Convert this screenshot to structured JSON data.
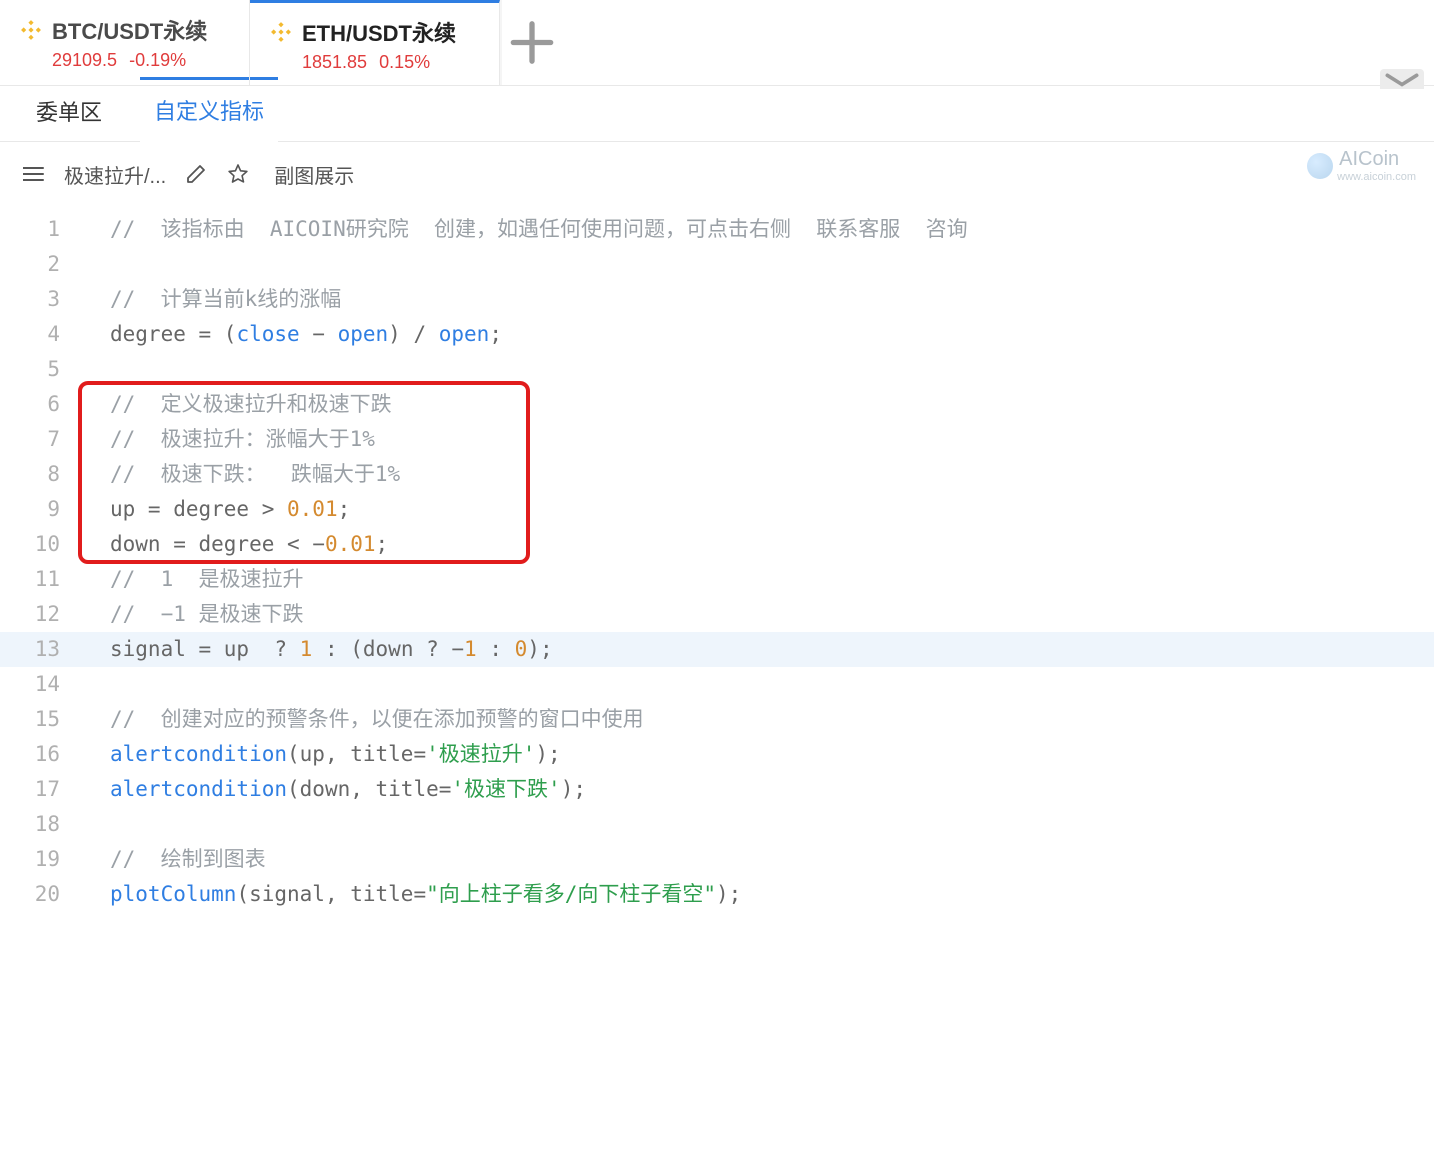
{
  "tabs": [
    {
      "name": "BTC/USDT永续",
      "price": "29109.5",
      "change": "-0.19%"
    },
    {
      "name": "ETH/USDT永续",
      "price": "1851.85",
      "change": "0.15%"
    }
  ],
  "subnav": {
    "orders": "委单区",
    "custom": "自定义指标"
  },
  "toolbar": {
    "script_name": "极速拉升/...",
    "side_label": "副图展示"
  },
  "watermark": {
    "brand": "AICoin",
    "url": "www.aicoin.com"
  },
  "code": {
    "lines": [
      {
        "n": "1",
        "type": "comment",
        "text": "//  该指标由  AICOIN研究院  创建，如遇任何使用问题，可点击右侧  联系客服  咨询"
      },
      {
        "n": "2",
        "type": "blank",
        "text": ""
      },
      {
        "n": "3",
        "type": "comment",
        "text": "//  计算当前k线的涨幅"
      },
      {
        "n": "4",
        "type": "l4",
        "segs": {
          "a": "degree = (",
          "close": "close",
          "dash": " − ",
          "open": "open",
          "b": ") / ",
          "open2": "open",
          "semi": ";"
        }
      },
      {
        "n": "5",
        "type": "blank",
        "text": ""
      },
      {
        "n": "6",
        "type": "comment",
        "text": "//  定义极速拉升和极速下跌"
      },
      {
        "n": "7",
        "type": "comment",
        "text": "//  极速拉升：涨幅大于1%"
      },
      {
        "n": "8",
        "type": "comment",
        "text": "//  极速下跌：  跌幅大于1%"
      },
      {
        "n": "9",
        "type": "l9",
        "segs": {
          "a": "up = degree > ",
          "num": "0.01",
          "semi": ";"
        }
      },
      {
        "n": "10",
        "type": "l10",
        "segs": {
          "a": "down = degree < ",
          "neg": "−",
          "num": "0.01",
          "semi": ";"
        }
      },
      {
        "n": "11",
        "type": "comment",
        "text": "//  1  是极速拉升"
      },
      {
        "n": "12",
        "type": "comment",
        "text": "//  −1 是极速下跌"
      },
      {
        "n": "13",
        "type": "l13",
        "segs": {
          "a": "signal = up  ? ",
          "one": "1",
          "b": " : (down ? ",
          "neg": "−",
          "one2": "1",
          "c": " : ",
          "zero": "0",
          "d": ");"
        }
      },
      {
        "n": "14",
        "type": "blank",
        "text": ""
      },
      {
        "n": "15",
        "type": "comment",
        "text": "//  创建对应的预警条件，以便在添加预警的窗口中使用"
      },
      {
        "n": "16",
        "type": "l16",
        "segs": {
          "fn": "alertcondition",
          "args1": "(up, title=",
          "str": "'极速拉升'",
          "end": ");"
        }
      },
      {
        "n": "17",
        "type": "l17",
        "segs": {
          "fn": "alertcondition",
          "args1": "(down, title=",
          "str": "'极速下跌'",
          "end": ");"
        }
      },
      {
        "n": "18",
        "type": "blank",
        "text": ""
      },
      {
        "n": "19",
        "type": "comment",
        "text": "//  绘制到图表"
      },
      {
        "n": "20",
        "type": "l20",
        "segs": {
          "fn": "plotColumn",
          "args1": "(signal, title=",
          "str": "\"向上柱子看多/向下柱子看空\"",
          "end": ");"
        }
      }
    ],
    "highlight_line": "13",
    "red_box_from": "6",
    "red_box_to": "10"
  }
}
